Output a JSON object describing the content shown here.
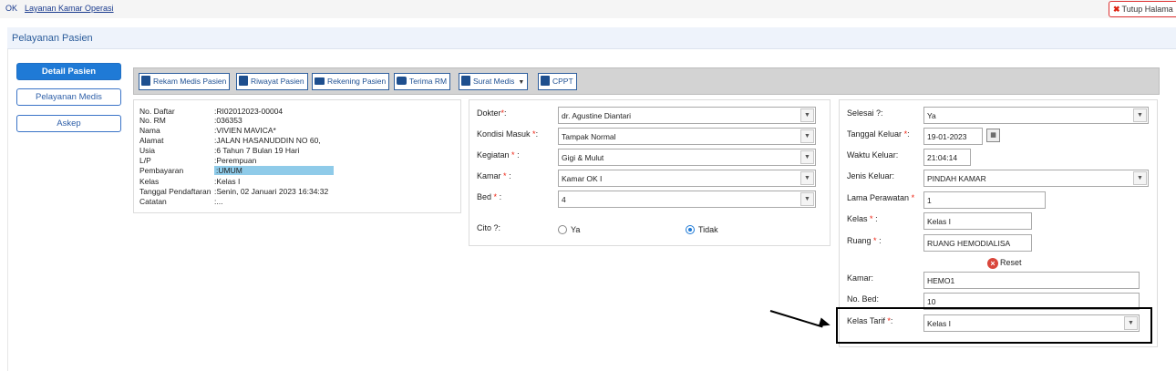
{
  "topbar": {
    "ok": "OK",
    "breadcrumb": "Layanan Kamar Operasi",
    "close_label": "Tutup Halama"
  },
  "page": {
    "title": "Pelayanan Pasien"
  },
  "nav": {
    "items": [
      {
        "label": "Detail Pasien",
        "active": true
      },
      {
        "label": "Pelayanan Medis",
        "active": false
      },
      {
        "label": "Askep",
        "active": false
      }
    ]
  },
  "toolbar": {
    "buttons": [
      {
        "label": "Rekam Medis Pasien",
        "icon": "document-icon"
      },
      {
        "label": "Riwayat Pasien",
        "icon": "history-document-icon"
      },
      {
        "label": "Rekening Pasien",
        "icon": "card-icon"
      },
      {
        "label": "Terima RM",
        "icon": "camera-icon"
      },
      {
        "label": "Surat Medis",
        "icon": "plus-document-icon"
      },
      {
        "label": "CPPT",
        "icon": "list-document-icon"
      }
    ]
  },
  "patient": {
    "rows": [
      {
        "label": "No. Daftar",
        "value": ":RI02012023-00004"
      },
      {
        "label": "No. RM",
        "value": ":036353"
      },
      {
        "label": "Nama",
        "value": ":VIVIEN MAVICA*"
      },
      {
        "label": "Alamat",
        "value": ":JALAN HASANUDDIN NO 60,"
      },
      {
        "label": "Usia",
        "value": ":6 Tahun 7 Bulan 19 Hari"
      },
      {
        "label": "L/P",
        "value": ":Perempuan"
      },
      {
        "label": "Pembayaran",
        "value": ":UMUM"
      },
      {
        "label": "Kelas",
        "value": ":Kelas I"
      },
      {
        "label": "Tanggal Pendaftaran",
        "value": ":Senin, 02 Januari 2023 16:34:32"
      },
      {
        "label": "Catatan",
        "value": ":..."
      }
    ]
  },
  "middle": {
    "dokter_label": "Dokter",
    "dokter_value": "dr. Agustine Diantari",
    "kondisi_label": "Kondisi Masuk",
    "kondisi_value": "Tampak Normal",
    "kegiatan_label": "Kegiatan",
    "kegiatan_value": "Gigi & Mulut",
    "kamar_label": "Kamar",
    "kamar_value": "Kamar OK I",
    "bed_label": "Bed",
    "bed_value": "4",
    "cito_label": "Cito ?:",
    "cito_yes": "Ya",
    "cito_no": "Tidak",
    "req": "*",
    "colon": ":",
    "colon_tight": ":"
  },
  "right": {
    "selesai_label": "Selesai ?:",
    "selesai_value": "Ya",
    "tgl_keluar_label": "Tanggal Keluar",
    "tgl_keluar_value": "19-01-2023",
    "waktu_label": "Waktu Keluar:",
    "waktu_value": "21:04:14",
    "jenis_label": "Jenis Keluar:",
    "jenis_value": "PINDAH KAMAR",
    "lama_label": "Lama Perawatan",
    "lama_value": "1",
    "kelas_label": "Kelas",
    "kelas_value": "Kelas I",
    "ruang_label": "Ruang",
    "ruang_value": "RUANG HEMODIALISA",
    "reset_label": "Reset",
    "kamar_label": "Kamar:",
    "kamar_value": "HEMO1",
    "nobed_label": "No. Bed:",
    "nobed_value": "10",
    "kelas_tarif_label": "Kelas Tarif",
    "kelas_tarif_value": "Kelas I",
    "req": "*",
    "colon": ":"
  }
}
